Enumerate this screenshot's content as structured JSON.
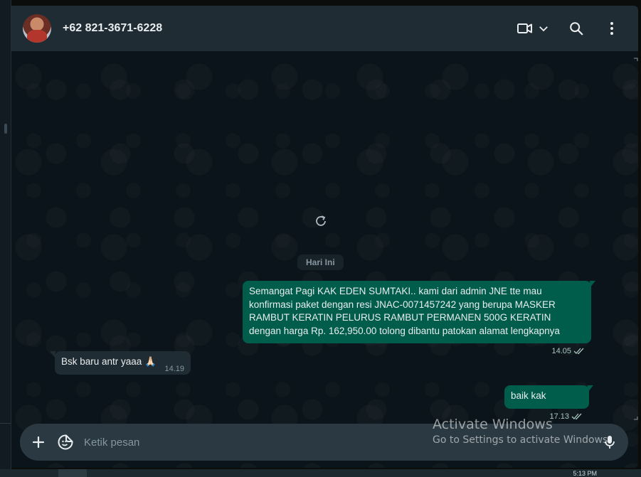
{
  "header": {
    "contact_name": "+62 821-3671-6228",
    "icons": [
      "video-call-icon",
      "chevron-down-icon",
      "search-icon",
      "menu-dots-icon"
    ]
  },
  "conversation": {
    "day_label": "Hari Ini",
    "messages": [
      {
        "direction": "outgoing",
        "text": "Semangat Pagi KAK EDEN SUMTAKI.. kami dari admin JNE tte mau konfirmasi paket dengan resi JNAC-0071457242 yang berupa MASKER RAMBUT KERATIN PELURUS RAMBUT PERMANEN 500G KERATIN dengan harga Rp. 162,950.00 tolong dibantu patokan alamat lengkapnya",
        "time": "14.05",
        "status": "read"
      },
      {
        "direction": "incoming",
        "text": "Bsk baru antr yaaa 🙏🏻",
        "time": "14.19"
      },
      {
        "direction": "outgoing",
        "text": "baik kak",
        "time": "17.13",
        "status": "read"
      }
    ]
  },
  "composer": {
    "placeholder": "Ketik pesan",
    "value": ""
  },
  "watermark": {
    "title": "Activate Windows",
    "subtitle": "Go to Settings to activate Windows."
  },
  "taskbar": {
    "clock": "5:13 PM"
  },
  "colors": {
    "outgoing_bubble": "#005c4b",
    "incoming_bubble": "#202c33",
    "header_bg": "#202c33",
    "chat_bg": "#0b141a",
    "accent": "#00a884"
  }
}
